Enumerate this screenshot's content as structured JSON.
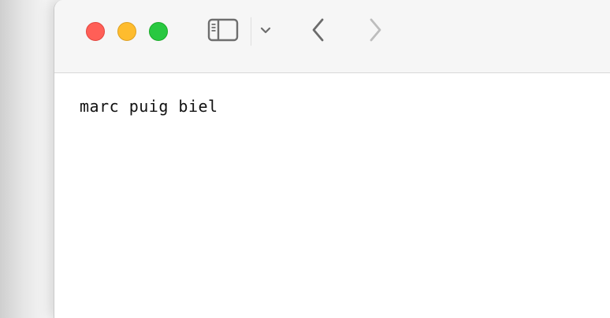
{
  "window": {
    "traffic_lights": {
      "close_color": "#ff5f57",
      "minimize_color": "#febc2e",
      "zoom_color": "#28c840"
    },
    "toolbar": {
      "icons": [
        "sidebar-icon",
        "chevron-down-icon",
        "chevron-left-icon",
        "chevron-right-icon"
      ],
      "back_enabled": true,
      "forward_enabled": false
    }
  },
  "document": {
    "text": "marc puig biel"
  }
}
